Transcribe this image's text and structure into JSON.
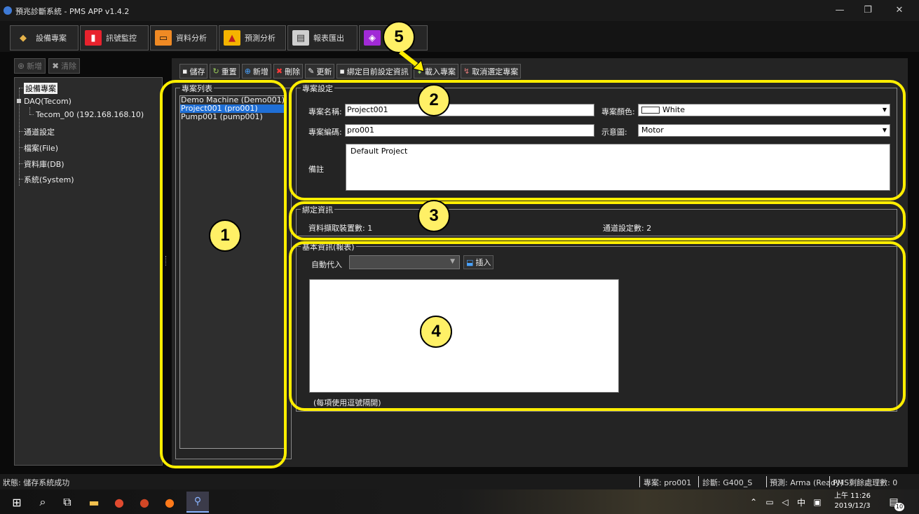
{
  "window": {
    "title": "預兆診斷系統 - PMS APP v1.4.2",
    "controls": {
      "minimize": "—",
      "restore": "❐",
      "close": "✕"
    }
  },
  "tabs": [
    {
      "label": "設備專案",
      "icon": "tag-icon",
      "color": "#e6b34a"
    },
    {
      "label": "訊號監控",
      "icon": "signal-monitor-icon",
      "color": "#e8222d"
    },
    {
      "label": "資料分析",
      "icon": "analysis-icon",
      "color": "#f08a24"
    },
    {
      "label": "預測分析",
      "icon": "prediction-chart-icon",
      "color": "#f5b400"
    },
    {
      "label": "報表匯出",
      "icon": "report-export-icon",
      "color": "#cfcfcf"
    },
    {
      "label": "",
      "icon": "binding-icon",
      "color": "#a12ad6"
    }
  ],
  "left_toolbar": {
    "add": "新增",
    "clear": "清除"
  },
  "tree": {
    "root": "設備專案",
    "daq": "DAQ(Tecom)",
    "daq_child": "Tecom_00 (192.168.168.10)",
    "channel": "通道設定",
    "file": "檔案(File)",
    "db": "資料庫(DB)",
    "system": "系統(System)"
  },
  "toolbar": {
    "save": "儲存",
    "reset": "重置",
    "add": "新增",
    "delete": "刪除",
    "update": "更新",
    "bind": "綁定目前設定資訊",
    "load": "載入專案",
    "cancel": "取消選定專案"
  },
  "project_list": {
    "title": "專案列表",
    "items": [
      "Demo Machine (Demo001)",
      "Project001 (pro001)",
      "Pump001 (pump001)"
    ],
    "selected_index": 1
  },
  "project_settings": {
    "title": "專案設定",
    "name_label": "專案名稱:",
    "name_value": "Project001",
    "code_label": "專案編碼:",
    "code_value": "pro001",
    "color_label": "專案顏色:",
    "color_value": "White",
    "diagram_label": "示意圖:",
    "diagram_value": "Motor",
    "note_label": "備註",
    "note_value": "Default Project"
  },
  "binding_info": {
    "title": "綁定資訊",
    "devices": "資料擷取裝置數: 1",
    "channels": "通道設定數: 2"
  },
  "basic_info": {
    "title": "基本資訊(報表)",
    "auto_fill_label": "自動代入",
    "insert_button": "插入",
    "hint": "(每項使用逗號隔開)"
  },
  "annotations": [
    "1",
    "2",
    "3",
    "4",
    "5"
  ],
  "status": {
    "left": "狀態:  儲存系統成功",
    "project": "專案: pro001",
    "diagnosis": "診斷: G400_S",
    "prediction": "預測: Arma (Ready)",
    "pms": "PMS剩餘處理數: 0"
  },
  "taskbar": {
    "time": "上午 11:26",
    "date": "2019/12/3",
    "ime": "中",
    "notifications": "10"
  }
}
